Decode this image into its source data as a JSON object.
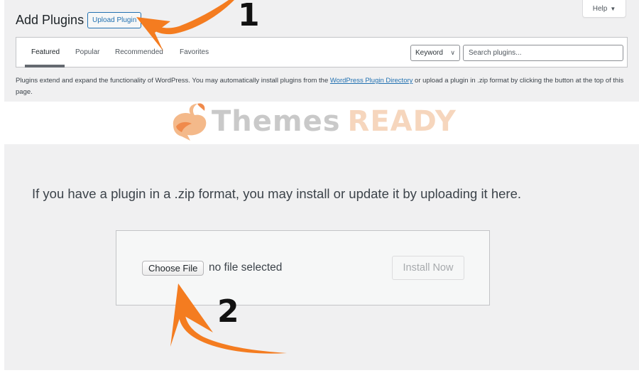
{
  "header": {
    "title": "Add Plugins",
    "upload_button": "Upload Plugin",
    "help_button": "Help"
  },
  "filter_bar": {
    "tabs": [
      {
        "label": "Featured",
        "active": true
      },
      {
        "label": "Popular",
        "active": false
      },
      {
        "label": "Recommended",
        "active": false
      },
      {
        "label": "Favorites",
        "active": false
      }
    ],
    "search_type": "Keyword",
    "search_placeholder": "Search plugins..."
  },
  "description": {
    "before_link": "Plugins extend and expand the functionality of WordPress. You may automatically install plugins from the ",
    "link_text": "WordPress Plugin Directory",
    "after_link": " or upload a plugin in .zip format by clicking the button at the top of this page."
  },
  "watermark": {
    "brand_part1": "Themes",
    "brand_part2": "READY"
  },
  "upload_section": {
    "info_text": "If you have a plugin in a .zip format, you may install or update it by uploading it here.",
    "choose_file_button": "Choose File",
    "file_status": "no file selected",
    "install_button": "Install Now"
  },
  "annotations": {
    "step1": "1",
    "step2": "2",
    "arrow_color": "#f47c20"
  },
  "colors": {
    "wp_blue": "#2271b1",
    "panel_bg": "#f0f0f1",
    "watermark_orange": "#f6d6bd"
  },
  "icons": {
    "help_caret": "caret-down-icon",
    "select_chevron": "chevron-down-icon",
    "watermark_logo": "rabbit-logo-icon"
  }
}
